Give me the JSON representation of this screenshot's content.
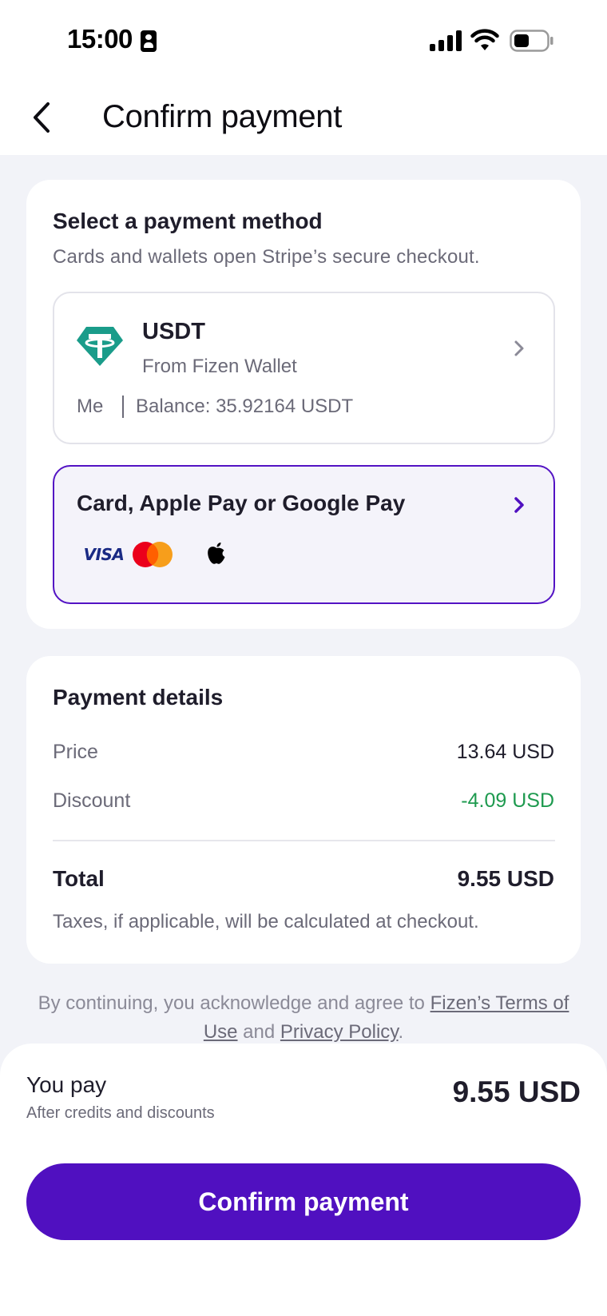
{
  "status_bar": {
    "time": "15:00",
    "icons": [
      "person-badge-icon",
      "signal-icon",
      "wifi-icon",
      "battery-icon"
    ]
  },
  "header": {
    "title": "Confirm payment",
    "back_icon": "chevron-left-icon"
  },
  "payment_method": {
    "title": "Select a payment method",
    "subtitle": "Cards and wallets open Stripe’s secure checkout.",
    "usdt_option": {
      "name": "USDT",
      "source": "From Fizen Wallet",
      "owner": "Me",
      "balance": "Balance: 35.92164 USDT",
      "icon": "tether-icon"
    },
    "card_option": {
      "label": "Card, Apple Pay or Google Pay",
      "visa_text": "VISA",
      "logos": [
        "visa-logo",
        "mastercard-logo",
        "apple-logo"
      ]
    }
  },
  "payment_details": {
    "title": "Payment details",
    "price_label": "Price",
    "price_value": "13.64 USD",
    "discount_label": "Discount",
    "discount_value": "-4.09 USD",
    "total_label": "Total",
    "total_value": "9.55 USD",
    "tax_note": "Taxes, if applicable, will be calculated at checkout."
  },
  "legal": {
    "prefix": "By continuing, you acknowledge and agree to ",
    "terms_link": "Fizen’s Terms of Use",
    "middle": " and ",
    "privacy_link": "Privacy Policy",
    "suffix": "."
  },
  "footer": {
    "you_pay_label": "You pay",
    "you_pay_sub": "After credits and discounts",
    "amount": "9.55 USD",
    "confirm_label": "Confirm payment"
  },
  "colors": {
    "accent": "#5010c0",
    "discount": "#1e9a4f",
    "tether": "#1a9c8a",
    "background": "#f2f3f8"
  }
}
